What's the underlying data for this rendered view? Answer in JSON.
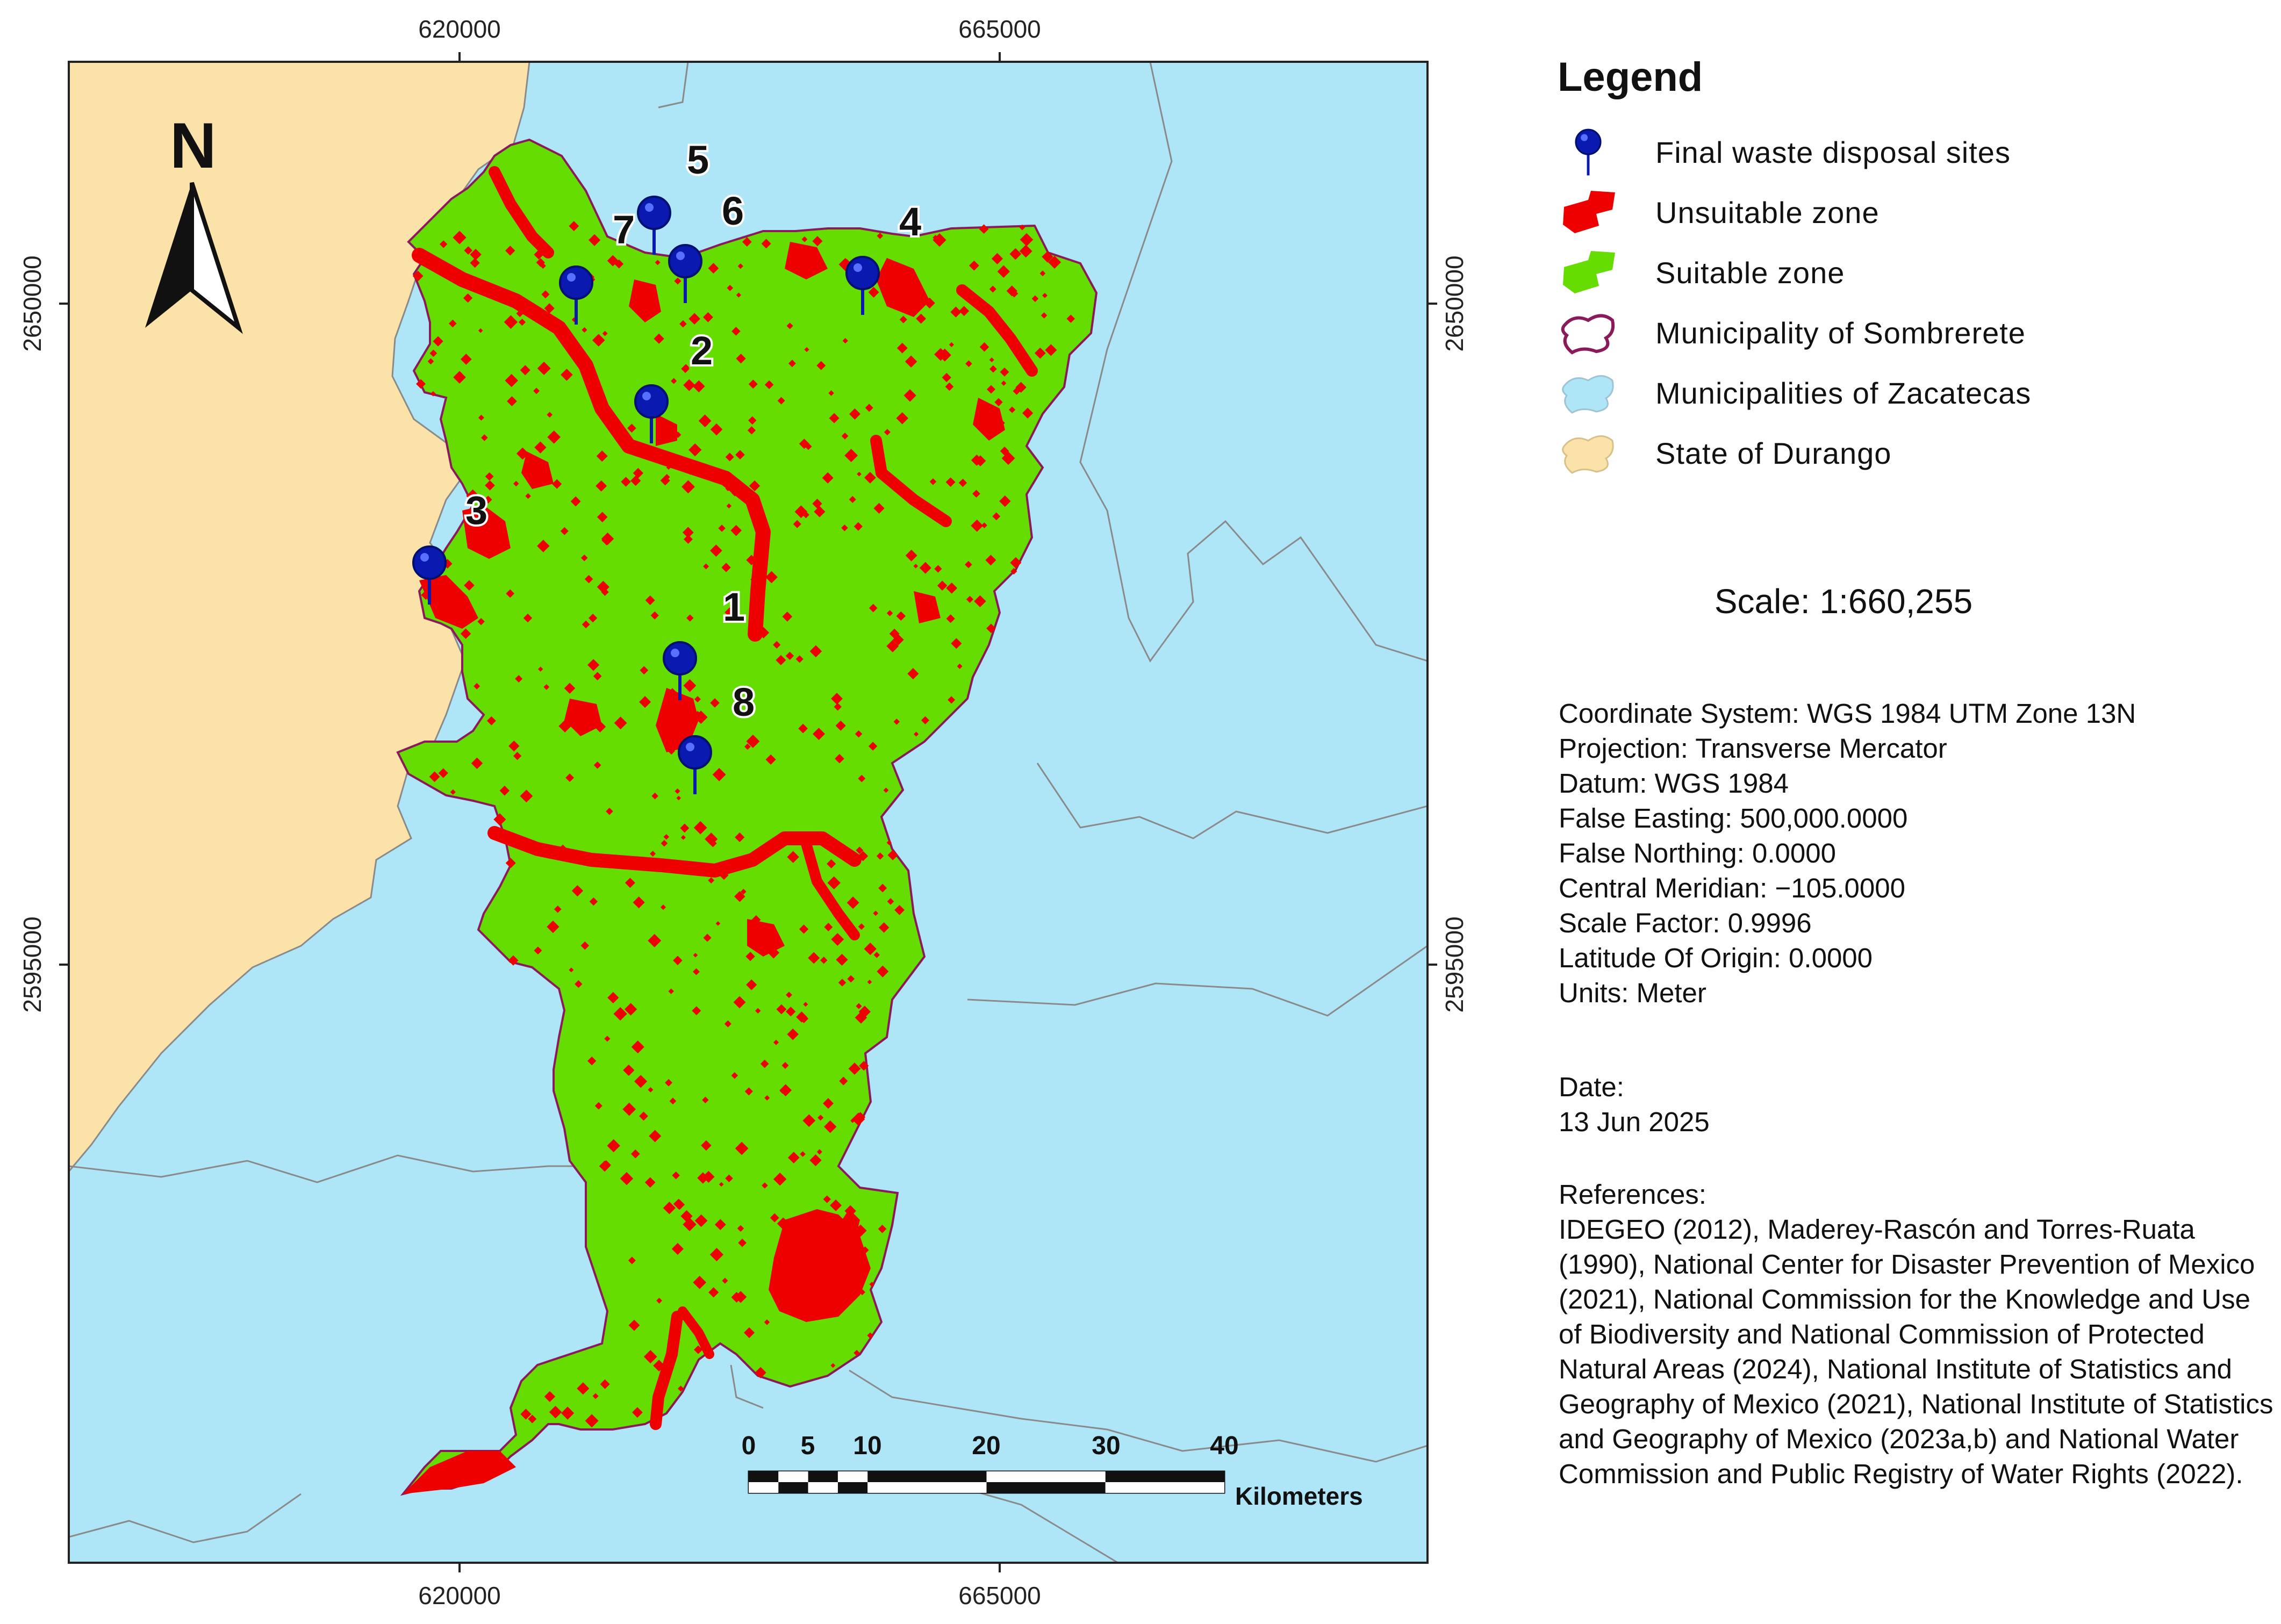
{
  "map": {
    "x_ticks": [
      "620000",
      "665000"
    ],
    "y_ticks": [
      "2650000",
      "2595000"
    ],
    "north_label": "N",
    "sites": [
      {
        "number": "1"
      },
      {
        "number": "2"
      },
      {
        "number": "3"
      },
      {
        "number": "4"
      },
      {
        "number": "5"
      },
      {
        "number": "6"
      },
      {
        "number": "7"
      },
      {
        "number": "8"
      }
    ],
    "scale_bar": {
      "ticks": [
        "0",
        "5",
        "10",
        "20",
        "30",
        "40"
      ],
      "unit": "Kilometers"
    },
    "colors": {
      "suitable": "#66dd00",
      "unsuitable": "#ee0000",
      "zacatecas": "#aee6f8",
      "durango": "#fbe2a8",
      "sombrerete_outline": "#8b1a5a",
      "pin": "#0a1ab0"
    }
  },
  "legend": {
    "title": "Legend",
    "items": [
      {
        "label": "Final waste disposal sites",
        "icon": "map-pin-icon"
      },
      {
        "label": "Unsuitable zone",
        "icon": "red-patch-icon"
      },
      {
        "label": "Suitable zone",
        "icon": "green-patch-icon"
      },
      {
        "label": "Municipality of  Sombrerete",
        "icon": "outline-patch-icon"
      },
      {
        "label": "Municipalities of  Zacatecas",
        "icon": "blue-patch-icon"
      },
      {
        "label": "State of  Durango",
        "icon": "tan-patch-icon"
      }
    ]
  },
  "scale_text": "Scale: 1:660,255",
  "metadata": [
    "Coordinate System: WGS 1984 UTM Zone 13N",
    "Projection: Transverse Mercator",
    "Datum: WGS 1984",
    "False Easting: 500,000.0000",
    "False Northing: 0.0000",
    "Central Meridian: −105.0000",
    "Scale Factor: 0.9996",
    "Latitude Of Origin: 0.0000",
    "Units: Meter"
  ],
  "date": {
    "label": "Date:",
    "value": "13 Jun 2025"
  },
  "references": {
    "label": "References:",
    "text": "IDEGEO (2012), Maderey-Rascón and Torres-Ruata (1990), National Center for Disaster Prevention of Mexico (2021), National Commission for the Knowledge and Use of Biodiversity and National Commission of Protected Natural Areas (2024), National Institute of Statistics and Geography of Mexico (2021), National Institute of Statistics and Geography of Mexico (2023a,b) and National Water Commission and Public Registry of Water Rights (2022)."
  }
}
